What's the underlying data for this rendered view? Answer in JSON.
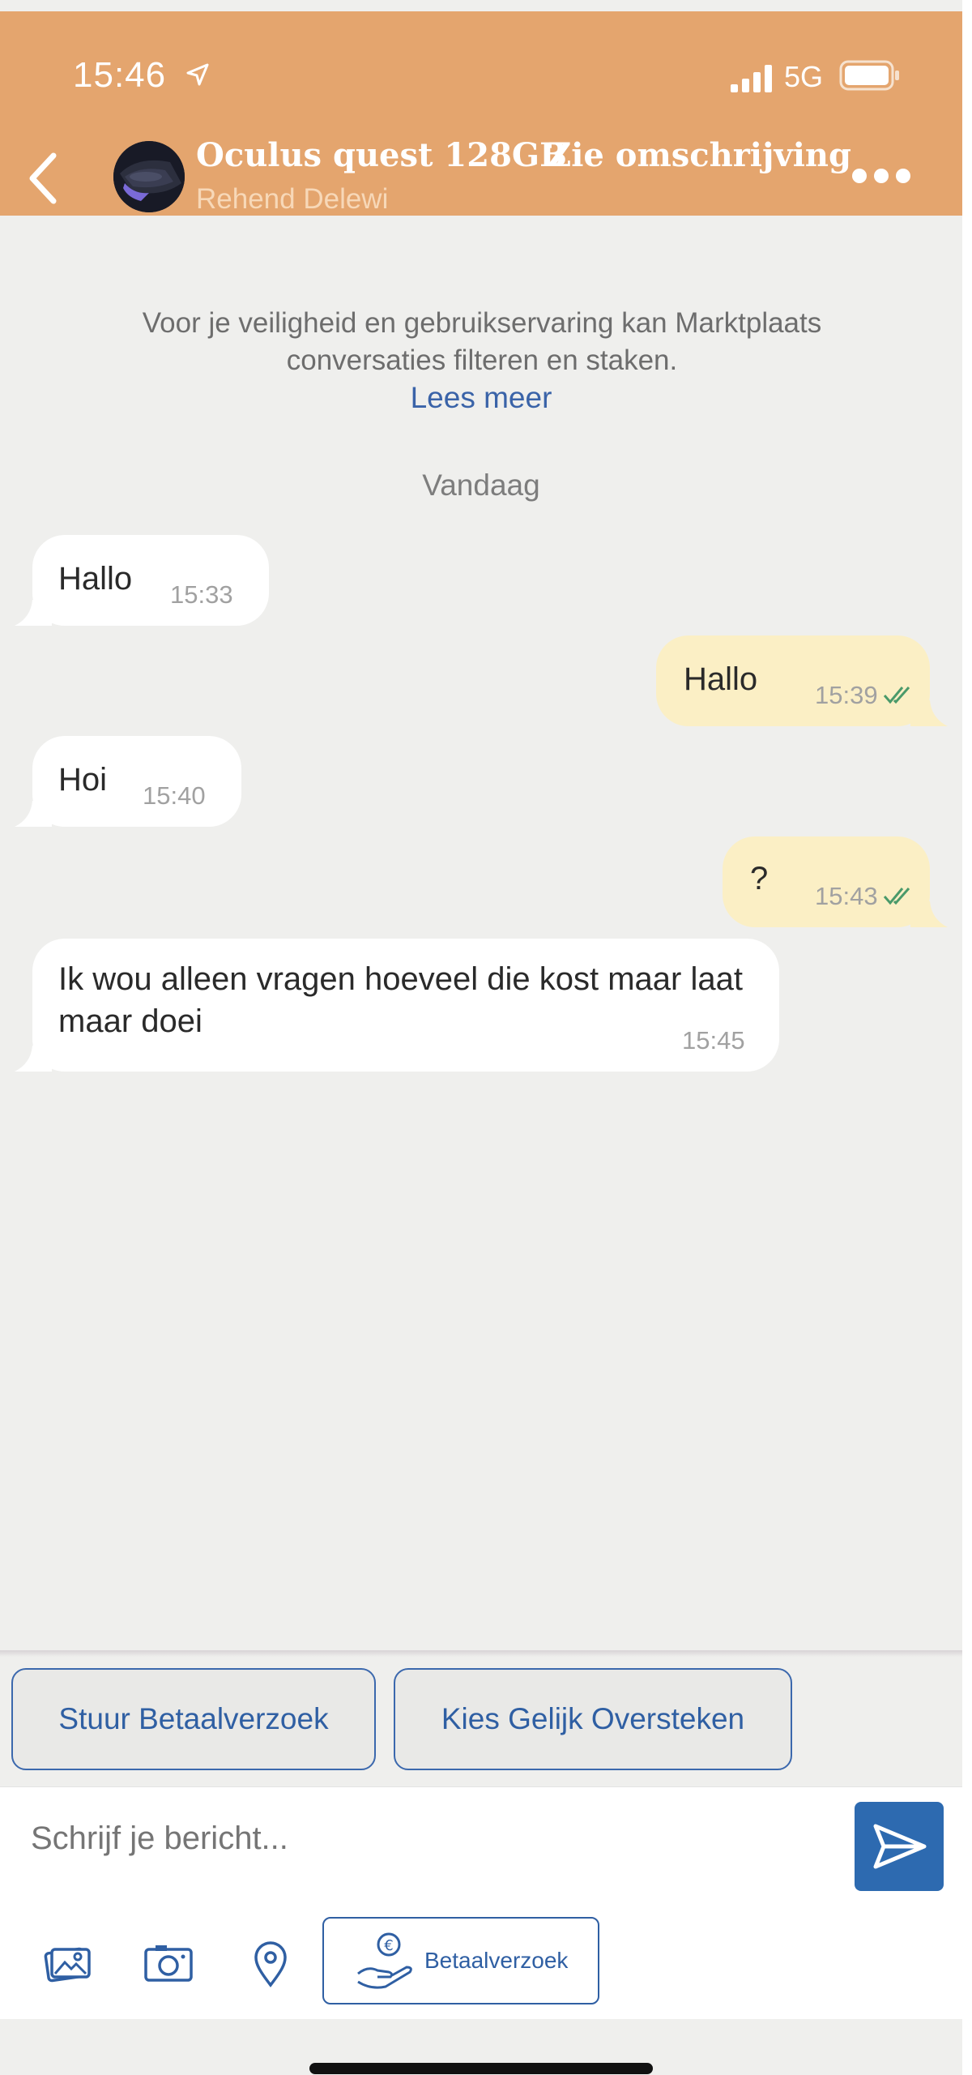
{
  "status_bar": {
    "time": "15:46",
    "network": "5G"
  },
  "header": {
    "title": "Oculus quest 128GB",
    "seller": "Rehend Delewi",
    "description_link": "Zie omschrijving"
  },
  "notice": {
    "text": "Voor je veiligheid en gebruikservaring kan Marktplaats conversaties filteren en staken.",
    "read_more": "Lees meer"
  },
  "day_label": "Vandaag",
  "messages": [
    {
      "direction": "incoming",
      "text": "Hallo",
      "time": "15:33"
    },
    {
      "direction": "outgoing",
      "text": "Hallo",
      "time": "15:39",
      "status": "read"
    },
    {
      "direction": "incoming",
      "text": "Hoi",
      "time": "15:40"
    },
    {
      "direction": "outgoing",
      "text": "?",
      "time": "15:43",
      "status": "read"
    },
    {
      "direction": "incoming",
      "text": "Ik wou alleen vragen hoeveel die kost maar laat maar doei",
      "time": "15:45"
    }
  ],
  "quick_actions": {
    "payment_request": "Stuur Betaalverzoek",
    "fair_exchange": "Kies Gelijk Oversteken"
  },
  "composer": {
    "placeholder": "Schrijf je bericht..."
  },
  "toolbar": {
    "icons": [
      "gallery-icon",
      "camera-icon",
      "location-icon",
      "payment-hand-icon",
      "send-icon"
    ],
    "payment_label": "Betaalverzoek"
  },
  "colors": {
    "header": "#e4a56e",
    "background": "#efefed",
    "incoming_bubble": "#ffffff",
    "outgoing_bubble": "#fbefc5",
    "accent": "#2d6ab0",
    "read_tick": "#4a9a6a"
  }
}
